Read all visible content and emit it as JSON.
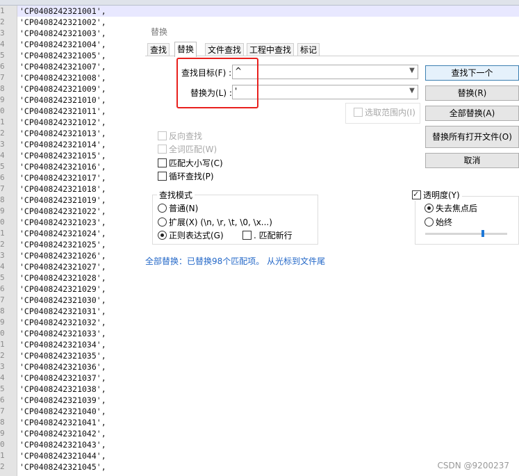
{
  "editor": {
    "lines": [
      {
        "no": "1",
        "text": "'CP0408242321001',"
      },
      {
        "no": "2",
        "text": "'CP0408242321002',"
      },
      {
        "no": "3",
        "text": "'CP0408242321003',"
      },
      {
        "no": "4",
        "text": "'CP0408242321004',"
      },
      {
        "no": "5",
        "text": "'CP0408242321005',"
      },
      {
        "no": "6",
        "text": "'CP0408242321007',"
      },
      {
        "no": "7",
        "text": "'CP0408242321008',"
      },
      {
        "no": "8",
        "text": "'CP0408242321009',"
      },
      {
        "no": "9",
        "text": "'CP0408242321010',"
      },
      {
        "no": "0",
        "text": "'CP0408242321011',"
      },
      {
        "no": "1",
        "text": "'CP0408242321012',"
      },
      {
        "no": "2",
        "text": "'CP0408242321013',"
      },
      {
        "no": "3",
        "text": "'CP0408242321014',"
      },
      {
        "no": "4",
        "text": "'CP0408242321015',"
      },
      {
        "no": "5",
        "text": "'CP0408242321016',"
      },
      {
        "no": "6",
        "text": "'CP0408242321017',"
      },
      {
        "no": "7",
        "text": "'CP0408242321018',"
      },
      {
        "no": "8",
        "text": "'CP0408242321019',"
      },
      {
        "no": "9",
        "text": "'CP0408242321022',"
      },
      {
        "no": "0",
        "text": "'CP0408242321023',"
      },
      {
        "no": "1",
        "text": "'CP0408242321024',"
      },
      {
        "no": "2",
        "text": "'CP0408242321025',"
      },
      {
        "no": "3",
        "text": "'CP0408242321026',"
      },
      {
        "no": "4",
        "text": "'CP0408242321027',"
      },
      {
        "no": "5",
        "text": "'CP0408242321028',"
      },
      {
        "no": "6",
        "text": "'CP0408242321029',"
      },
      {
        "no": "7",
        "text": "'CP0408242321030',"
      },
      {
        "no": "8",
        "text": "'CP0408242321031',"
      },
      {
        "no": "9",
        "text": "'CP0408242321032',"
      },
      {
        "no": "0",
        "text": "'CP0408242321033',"
      },
      {
        "no": "1",
        "text": "'CP0408242321034',"
      },
      {
        "no": "2",
        "text": "'CP0408242321035',"
      },
      {
        "no": "3",
        "text": "'CP0408242321036',"
      },
      {
        "no": "4",
        "text": "'CP0408242321037',"
      },
      {
        "no": "5",
        "text": "'CP0408242321038',"
      },
      {
        "no": "6",
        "text": "'CP0408242321039',"
      },
      {
        "no": "7",
        "text": "'CP0408242321040',"
      },
      {
        "no": "8",
        "text": "'CP0408242321041',"
      },
      {
        "no": "9",
        "text": "'CP0408242321042',"
      },
      {
        "no": "0",
        "text": "'CP0408242321043',"
      },
      {
        "no": "1",
        "text": "'CP0408242321044',"
      },
      {
        "no": "2",
        "text": "'CP0408242321045',"
      }
    ]
  },
  "dialog": {
    "title": "替换",
    "tabs": [
      "查找",
      "替换",
      "文件查找",
      "工程中查找",
      "标记"
    ],
    "find_label": "查找目标(F) :",
    "find_value": "^",
    "replace_label": "替换为(L) :",
    "replace_value": "'",
    "in_selection": "选取范围内(I)",
    "buttons": {
      "find_next": "查找下一个",
      "replace": "替换(R)",
      "replace_all": "全部替换(A)",
      "replace_all_open": "替换所有打开文件(O)",
      "cancel": "取消"
    },
    "options": {
      "backward": "反向查找",
      "whole_word": "全词匹配(W)",
      "match_case": "匹配大小写(C)",
      "wrap": "循环查找(P)"
    },
    "mode": {
      "title": "查找模式",
      "normal": "普通(N)",
      "extended": "扩展(X) (\\n, \\r, \\t, \\0, \\x...)",
      "regex": "正则表达式(G)",
      "dot_newline": ". 匹配新行"
    },
    "transparency": {
      "title": "透明度(Y)",
      "on_lose_focus": "失去焦点后",
      "always": "始终",
      "level": 0.7
    },
    "status": "全部替换：已替换98个匹配项。 从光标到文件尾"
  },
  "watermark": "CSDN @9200237",
  "colors": {
    "highlight": "#e8201d",
    "status": "#2468c8"
  }
}
